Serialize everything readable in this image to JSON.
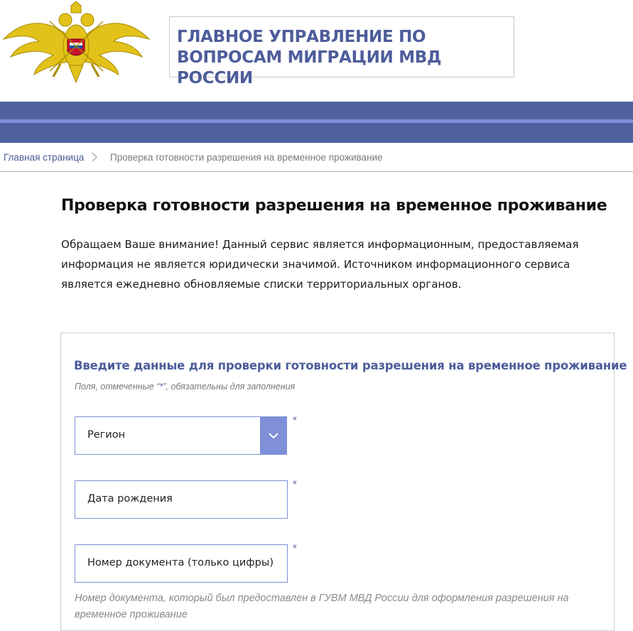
{
  "header": {
    "title": "ГЛАВНОЕ УПРАВЛЕНИЕ ПО ВОПРОСАМ МИГРАЦИИ МВД РОССИИ",
    "emblem": "coat-of-arms-emblem",
    "colors": {
      "band": "#4f619f",
      "band_line": "#7f8fd8",
      "title": "#4d5d9b"
    }
  },
  "breadcrumb": {
    "home": "Главная страница",
    "current": "Проверка готовности разрешения на временное проживание"
  },
  "main": {
    "title": "Проверка готовности разрешения на временное проживание",
    "notice": "Обращаем Ваше внимание! Данный сервис является информационным, предоставляемая информация не является юридически значимой. Источником информационного сервиса является ежедневно обновляемые списки территориальных органов."
  },
  "form": {
    "heading": "Введите данные для проверки готовности разрешения на временное проживание",
    "hint_prefix": "Поля, отмеченные “",
    "hint_star": "*",
    "hint_suffix": "”, обязательны для заполнения",
    "region_placeholder": "Регион",
    "birthdate_placeholder": "Дата рождения",
    "docnumber_placeholder": "Номер документа (только цифры)",
    "required_mark": "*",
    "doc_hint": "Номер документа, который был предоставлен в ГУВМ МВД России для оформления разрешения на временное проживание",
    "accent_color": "#7f8fd8"
  }
}
